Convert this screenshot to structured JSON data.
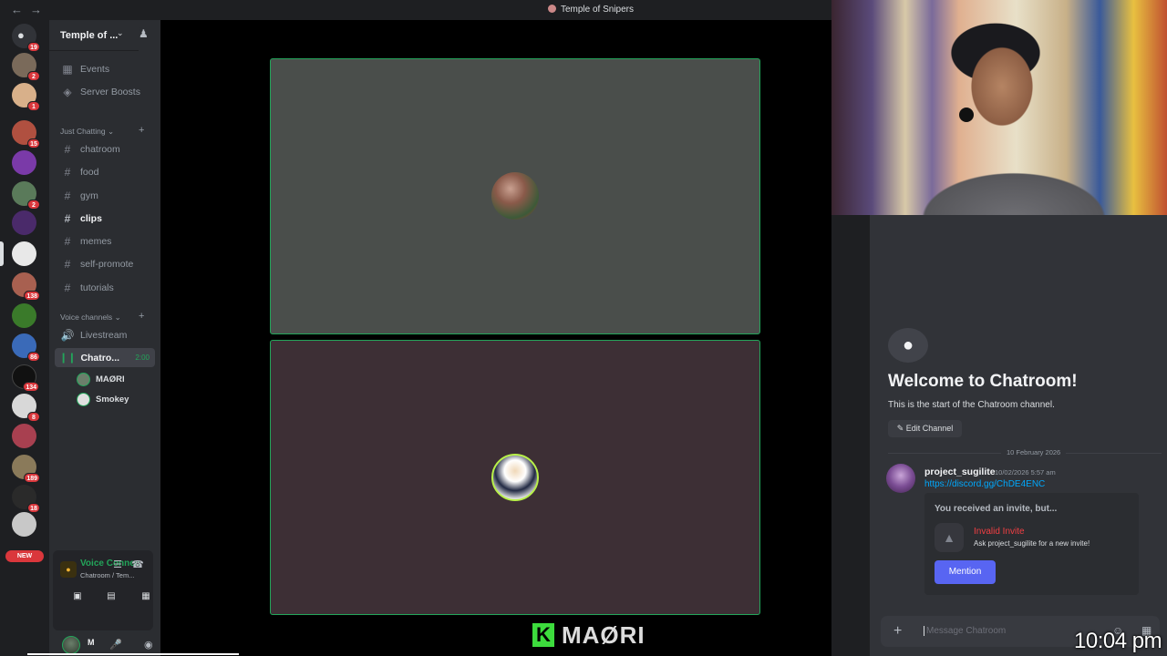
{
  "window": {
    "title": "Temple of Snipers"
  },
  "server": {
    "name": "Temple of ...",
    "top_items": [
      {
        "label": "Events"
      },
      {
        "label": "Server Boosts"
      }
    ],
    "categories": [
      {
        "name": "Just Chatting"
      },
      {
        "name": "Voice channels"
      }
    ],
    "text_channels": [
      {
        "label": "chatroom"
      },
      {
        "label": "food"
      },
      {
        "label": "gym"
      },
      {
        "label": "clips"
      },
      {
        "label": "memes"
      },
      {
        "label": "self-promote"
      },
      {
        "label": "tutorials"
      }
    ],
    "voice_channels": [
      {
        "label": "Livestream"
      },
      {
        "label": "Chatro...",
        "timer": "2:00"
      }
    ],
    "voice_users": [
      {
        "name": "MAØRI"
      },
      {
        "name": "Smokey"
      }
    ]
  },
  "rail": {
    "badges": [
      "19",
      "2",
      "1",
      "15",
      "2",
      "138",
      "86",
      "134",
      "8",
      "189",
      "18"
    ],
    "new_label": "NEW"
  },
  "voice_panel": {
    "status": "Voice Connected",
    "subtitle": "Chatroom / Tem..."
  },
  "user": {
    "name": "M"
  },
  "stage": {
    "brand_text": "MAØRI",
    "brand_letter": "K"
  },
  "chat": {
    "welcome_title": "Welcome to Chatroom!",
    "welcome_sub": "This is the start of the Chatroom channel.",
    "edit_label": "Edit Channel",
    "date_divider": "10 February 2026",
    "message": {
      "author": "project_sugilite",
      "timestamp": "10/02/2026 5:57 am",
      "link": "https://discord.gg/ChDE4ENC",
      "invite_header": "You received an invite, but...",
      "invite_title": "Invalid Invite",
      "invite_sub": "Ask project_sugilite for a new invite!",
      "mention_label": "Mention"
    },
    "composer_placeholder": "Message Chatroom"
  },
  "overlay": {
    "clock": "10:04 pm"
  },
  "colors": {
    "accent_green": "#23a55a",
    "blurple": "#5865f2",
    "danger": "#f23f43",
    "link": "#00a8fc"
  }
}
